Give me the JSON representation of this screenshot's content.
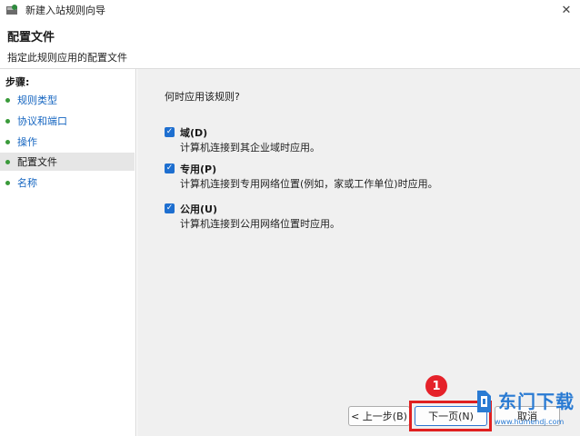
{
  "window": {
    "title": "新建入站规则向导",
    "close_glyph": "✕"
  },
  "header": {
    "title": "配置文件",
    "subtitle": "指定此规则应用的配置文件"
  },
  "steps": {
    "title": "步骤:",
    "items": [
      {
        "label": "规则类型",
        "active": false
      },
      {
        "label": "协议和端口",
        "active": false
      },
      {
        "label": "操作",
        "active": false
      },
      {
        "label": "配置文件",
        "active": true
      },
      {
        "label": "名称",
        "active": false
      }
    ]
  },
  "panel": {
    "question": "何时应用该规则?",
    "options": [
      {
        "label": "域(D)",
        "desc": "计算机连接到其企业域时应用。",
        "checked": true
      },
      {
        "label": "专用(P)",
        "desc": "计算机连接到专用网络位置(例如，家或工作单位)时应用。",
        "checked": true
      },
      {
        "label": "公用(U)",
        "desc": "计算机连接到公用网络位置时应用。",
        "checked": true
      }
    ]
  },
  "buttons": {
    "back": "< 上一步(B)",
    "next": "下一页(N)",
    "cancel": "取消"
  },
  "annotation": {
    "marker": "1",
    "color": "#e02020"
  },
  "watermark": {
    "text": "东门下载",
    "url": "www.humendj.com"
  },
  "colors": {
    "accent": "#1e6fd0",
    "link": "#1565c0",
    "step_dot": "#3a9a3a"
  }
}
